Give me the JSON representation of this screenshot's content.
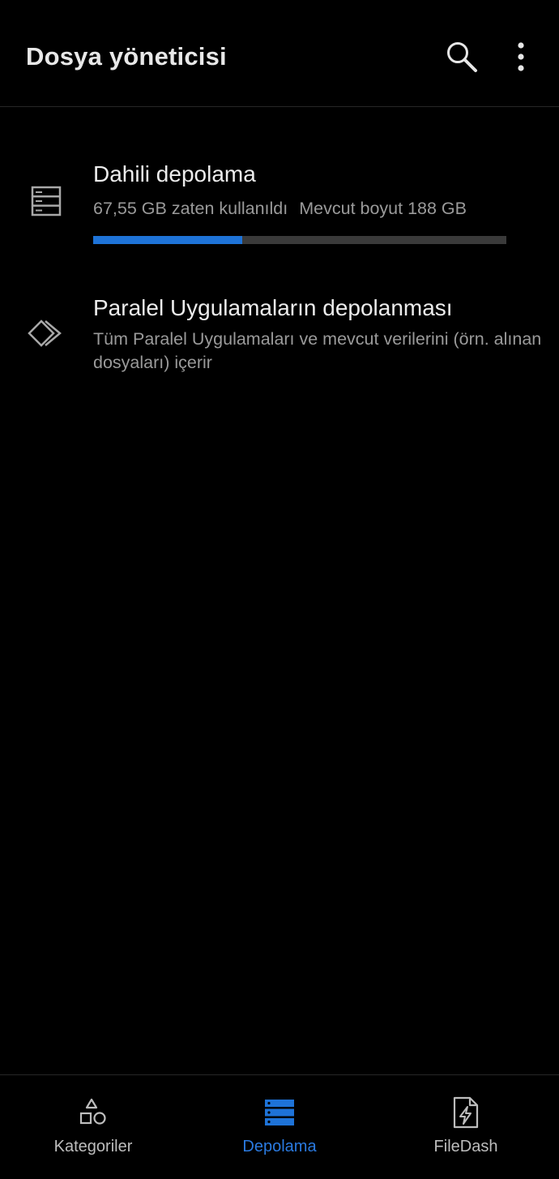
{
  "app_bar": {
    "title": "Dosya yöneticisi",
    "search_icon": "search-icon",
    "more_icon": "more-vertical-icon"
  },
  "storage": {
    "internal": {
      "icon": "storage-list-icon",
      "title": "Dahili depolama",
      "used": "67,55 GB zaten kullanıldı",
      "total": "Mevcut boyut 188 GB",
      "used_fraction": 0.36
    },
    "parallel": {
      "icon": "parallel-apps-icon",
      "title": "Paralel Uygulamaların depolanması",
      "description": "Tüm Paralel Uygulamaları ve mevcut verilerini (örn. alınan dosyaları) içerir"
    }
  },
  "bottom_nav": {
    "items": [
      {
        "label": "Kategoriler",
        "icon": "categories-icon",
        "active": false
      },
      {
        "label": "Depolama",
        "icon": "storage-icon",
        "active": true
      },
      {
        "label": "FileDash",
        "icon": "filedash-icon",
        "active": false
      }
    ]
  },
  "colors": {
    "background": "#000000",
    "accent": "#1e73d8",
    "progress_track": "#3a3a3a",
    "secondary_text": "#9a9a9a"
  }
}
